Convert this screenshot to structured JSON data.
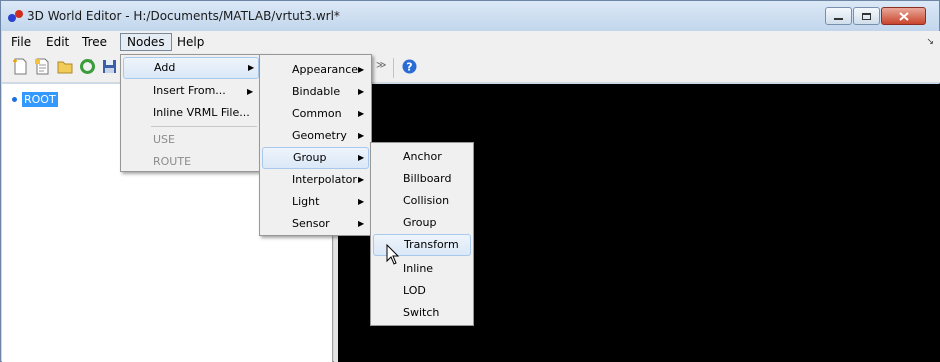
{
  "window": {
    "title": "3D World Editor - H:/Documents/MATLAB/vrtut3.wrl*",
    "controls": {
      "minimize": "minimize-icon",
      "maximize": "maximize-icon",
      "close": "close-icon"
    }
  },
  "menubar": {
    "items": [
      {
        "label": "File"
      },
      {
        "label": "Edit"
      },
      {
        "label": "Tree"
      },
      {
        "label": "Nodes",
        "open": true
      },
      {
        "label": "Help"
      }
    ],
    "corner_icon": "dock-arrow-icon"
  },
  "toolbar": {
    "icons": [
      "new-file-icon",
      "new-from-template-icon",
      "open-folder-icon",
      "reload-icon",
      "save-icon",
      "more-icon",
      "help-icon"
    ]
  },
  "tree": {
    "root_label": "ROOT"
  },
  "nodes_menu": {
    "items": [
      {
        "label": "Add",
        "submenu": true,
        "highlighted": true
      },
      {
        "label": "Insert From...",
        "submenu": true
      },
      {
        "label": "Inline VRML File..."
      },
      {
        "label": "USE",
        "disabled": true
      },
      {
        "label": "ROUTE",
        "disabled": true
      }
    ]
  },
  "add_menu": {
    "items": [
      {
        "label": "Appearance",
        "submenu": true
      },
      {
        "label": "Bindable",
        "submenu": true
      },
      {
        "label": "Common",
        "submenu": true
      },
      {
        "label": "Geometry",
        "submenu": true
      },
      {
        "label": "Group",
        "submenu": true,
        "highlighted": true
      },
      {
        "label": "Interpolator",
        "submenu": true
      },
      {
        "label": "Light",
        "submenu": true
      },
      {
        "label": "Sensor",
        "submenu": true
      }
    ]
  },
  "group_menu": {
    "items": [
      {
        "label": "Anchor"
      },
      {
        "label": "Billboard"
      },
      {
        "label": "Collision"
      },
      {
        "label": "Group"
      },
      {
        "label": "Transform",
        "highlighted": true
      },
      {
        "label": "Inline"
      },
      {
        "label": "LOD"
      },
      {
        "label": "Switch"
      }
    ]
  },
  "colors": {
    "selection": "#3399ff",
    "viewport": "#000000",
    "menu_bg": "#f0f0f0"
  }
}
